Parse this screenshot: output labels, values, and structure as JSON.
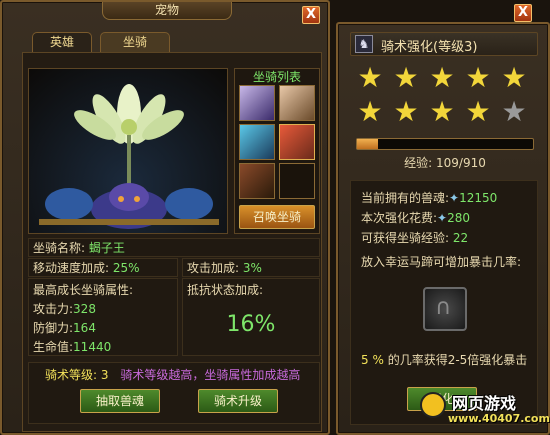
{
  "left_panel": {
    "title": "宠物",
    "close": "X",
    "tabs": [
      {
        "label": "英雄"
      },
      {
        "label": "坐骑"
      }
    ],
    "mount_list_title": "坐骑列表",
    "summon_button": "召唤坐骑",
    "mount_name_label": "坐骑名称:",
    "mount_name": "蝎子王",
    "move_speed_label": "移动速度加成:",
    "move_speed": "25%",
    "attack_bonus_label": "攻击加成:",
    "attack_bonus": "3%",
    "max_growth_label": "最高成长坐骑属性:",
    "resist_label": "抵抗状态加成:",
    "resist_value": "16%",
    "stats": [
      {
        "label": "攻击力:",
        "value": "328"
      },
      {
        "label": "防御力:",
        "value": "164"
      },
      {
        "label": "生命值:",
        "value": "11440"
      }
    ],
    "riding_level_label": "骑术等级:",
    "riding_level": "3",
    "riding_hint": "骑术等级越高，坐骑属性加成越高",
    "extract_button": "抽取兽魂",
    "upgrade_button": "骑术升级"
  },
  "right_panel": {
    "close": "X",
    "title": "骑术强化(等级3)",
    "stars_total": 10,
    "stars_filled": 9,
    "progress": 0.12,
    "exp_label": "经验:",
    "exp_value": "109/910",
    "current_soul_label": "当前拥有的兽魂:",
    "current_soul": "12150",
    "cost_label": "本次强化花费:",
    "cost": "280",
    "gain_label": "可获得坐骑经验:",
    "gain": "22",
    "horseshoe_hint": "放入幸运马蹄可增加暴击几率:",
    "crit_percent": "5",
    "crit_unit": "%",
    "crit_text": "的几率获得2-5倍强化暴击",
    "confirm_button": "强化"
  },
  "watermark": {
    "text": "网页游戏",
    "url": "www.40407.com"
  },
  "colors": {
    "accent": "#7ee66a",
    "gold": "#f2e15a",
    "border": "#7a5a2c"
  }
}
